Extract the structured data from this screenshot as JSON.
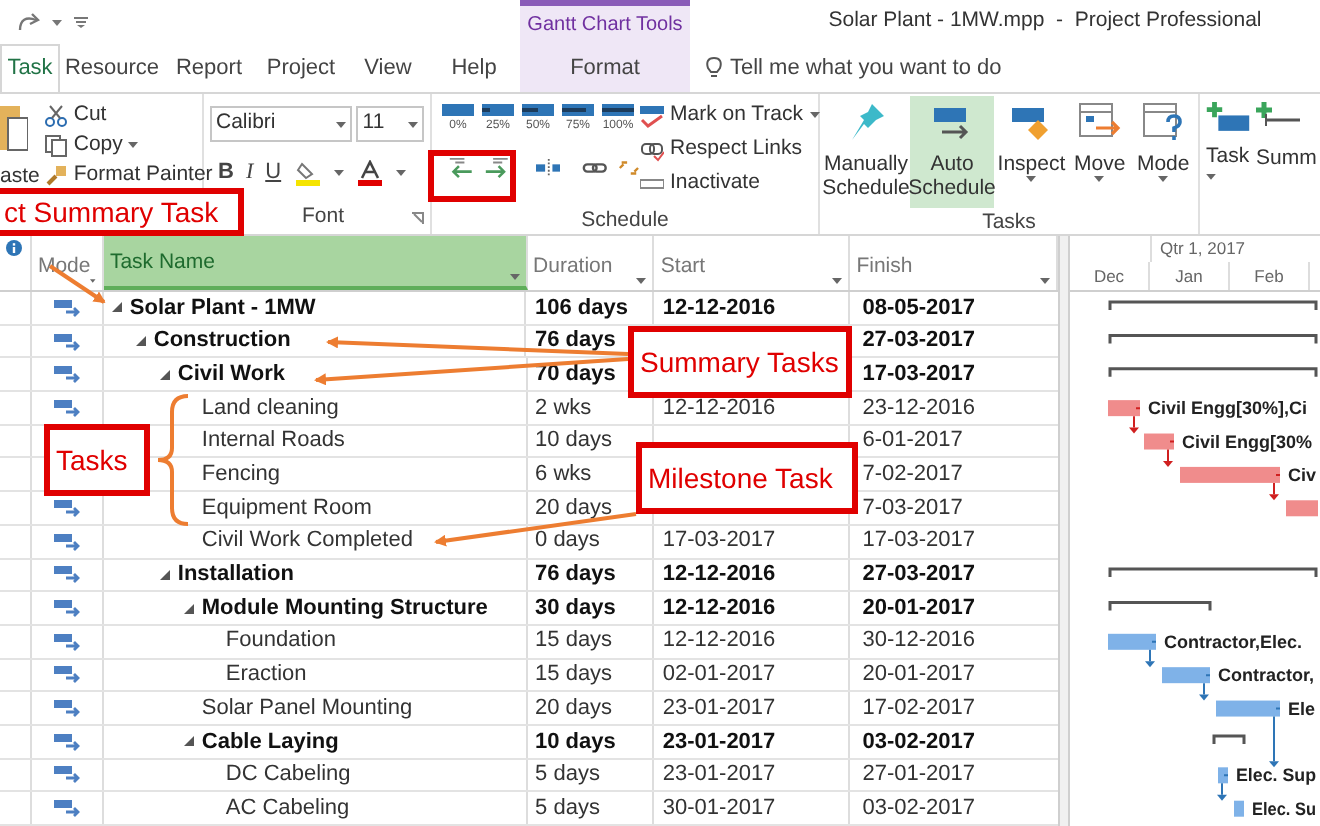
{
  "title_bar": {
    "title": "Solar Plant - 1MW.mpp  -  Project Professional",
    "contextual_header": "Gantt Chart Tools"
  },
  "tabs": [
    {
      "label": "Task",
      "selected": true,
      "kind": "standard"
    },
    {
      "label": "Resource",
      "selected": false,
      "kind": "standard"
    },
    {
      "label": "Report",
      "selected": false,
      "kind": "standard"
    },
    {
      "label": "Project",
      "selected": false,
      "kind": "standard"
    },
    {
      "label": "View",
      "selected": false,
      "kind": "standard"
    },
    {
      "label": "Help",
      "selected": false,
      "kind": "standard"
    },
    {
      "label": "Format",
      "selected": false,
      "kind": "contextual"
    }
  ],
  "tell_me": {
    "placeholder": "Tell me what you want to do"
  },
  "ribbon": {
    "clipboard": {
      "paste": "aste",
      "cut": "Cut",
      "copy": "Copy",
      "format_painter": "Format Painter"
    },
    "font": {
      "font_name": "Calibri",
      "font_size": "11",
      "bold": "B",
      "italic": "I",
      "underline": "U",
      "label": "Font"
    },
    "schedule": {
      "percent_buttons": [
        "0%",
        "25%",
        "50%",
        "75%",
        "100%"
      ],
      "commands": [
        "Mark on Track",
        "Respect Links",
        "Inactivate"
      ],
      "label": "Schedule"
    },
    "tasks": {
      "buttons": [
        {
          "label": "Manually Schedule",
          "selected": false
        },
        {
          "label": "Auto Schedule",
          "selected": true
        },
        {
          "label": "Inspect",
          "selected": false
        },
        {
          "label": "Move",
          "selected": false
        },
        {
          "label": "Mode",
          "selected": false
        }
      ],
      "label": "Tasks"
    },
    "insert": {
      "buttons": [
        "Task",
        "Summ"
      ]
    }
  },
  "table": {
    "columns": [
      {
        "label": "Mode",
        "selected": false
      },
      {
        "label": "Task Name",
        "selected": true
      },
      {
        "label": "Duration",
        "selected": false
      },
      {
        "label": "Start",
        "selected": false
      },
      {
        "label": "Finish",
        "selected": false
      }
    ],
    "rows": [
      {
        "name": "Solar Plant - 1MW",
        "duration": "106 days",
        "start": "12-12-2016",
        "finish": "08-05-2017",
        "kind": "summary",
        "expanded": true,
        "bar": {
          "kind": "summary"
        },
        "children": [
          {
            "name": "Construction",
            "duration": "76 days",
            "finish": "27-03-2017",
            "kind": "summary",
            "expanded": true,
            "bar": {
              "kind": "summary"
            },
            "children": [
              {
                "name": "Civil Work",
                "duration": "70 days",
                "finish": "17-03-2017",
                "kind": "summary",
                "expanded": true,
                "bar": {
                  "kind": "summary"
                },
                "children": [
                  {
                    "name": "Land cleaning",
                    "duration": "2 wks",
                    "start": "12-12-2016",
                    "finish": "23-12-2016",
                    "kind": "task",
                    "bar": {
                      "kind": "task",
                      "color": "#f08c8c",
                      "label": "Civil Engg[30%],Ci"
                    }
                  },
                  {
                    "name": "Internal Roads",
                    "duration": "10 days",
                    "finish": "6-01-2017",
                    "kind": "task",
                    "bar": {
                      "kind": "task",
                      "color": "#f08c8c",
                      "label": "Civil Engg[30%"
                    }
                  },
                  {
                    "name": "Fencing",
                    "duration": "6 wks",
                    "finish": "7-02-2017",
                    "kind": "task",
                    "bar": {
                      "kind": "task",
                      "color": "#f08c8c",
                      "label": "Civ"
                    }
                  },
                  {
                    "name": "Equipment Room",
                    "duration": "20 days",
                    "finish": "7-03-2017",
                    "kind": "task",
                    "bar": {
                      "kind": "task",
                      "color": "#f08c8c"
                    }
                  },
                  {
                    "name": "Civil Work Completed",
                    "duration": "0 days",
                    "start": "17-03-2017",
                    "finish": "17-03-2017",
                    "kind": "task"
                  }
                ]
              },
              {
                "name": "Installation",
                "duration": "76 days",
                "start": "12-12-2016",
                "finish": "27-03-2017",
                "kind": "summary",
                "expanded": true,
                "bar": {
                  "kind": "summary"
                },
                "children": [
                  {
                    "name": "Module Mounting Structure",
                    "duration": "30 days",
                    "start": "12-12-2016",
                    "finish": "20-01-2017",
                    "kind": "summary",
                    "expanded": true,
                    "bar": {
                      "kind": "summary"
                    },
                    "children": [
                      {
                        "name": "Foundation",
                        "duration": "15 days",
                        "start": "12-12-2016",
                        "finish": "30-12-2016",
                        "kind": "task",
                        "bar": {
                          "kind": "task",
                          "color": "#7fb2e8",
                          "label": "Contractor,Elec."
                        }
                      },
                      {
                        "name": "Eraction",
                        "duration": "15 days",
                        "start": "02-01-2017",
                        "finish": "20-01-2017",
                        "kind": "task",
                        "bar": {
                          "kind": "task",
                          "color": "#7fb2e8",
                          "label": "Contractor,"
                        }
                      }
                    ]
                  },
                  {
                    "name": "Solar Panel Mounting",
                    "duration": "20 days",
                    "start": "23-01-2017",
                    "finish": "17-02-2017",
                    "kind": "task",
                    "bar": {
                      "kind": "task",
                      "color": "#7fb2e8",
                      "label": "Ele"
                    }
                  },
                  {
                    "name": "Cable Laying",
                    "duration": "10 days",
                    "start": "23-01-2017",
                    "finish": "03-02-2017",
                    "kind": "summary",
                    "expanded": true,
                    "bar": {
                      "kind": "summary"
                    },
                    "children": [
                      {
                        "name": "DC Cabeling",
                        "duration": "5 days",
                        "start": "23-01-2017",
                        "finish": "27-01-2017",
                        "kind": "task",
                        "bar": {
                          "kind": "task",
                          "color": "#7fb2e8",
                          "label": "Elec. Sup"
                        }
                      },
                      {
                        "name": "AC Cabeling",
                        "duration": "5 days",
                        "start": "30-01-2017",
                        "finish": "03-02-2017",
                        "kind": "task",
                        "bar": {
                          "kind": "task",
                          "color": "#7fb2e8",
                          "label": "Elec. Su"
                        }
                      }
                    ]
                  }
                ]
              }
            ]
          }
        ]
      }
    ]
  },
  "gantt": {
    "quarter": "Qtr 1, 2017",
    "months": [
      "Dec",
      "Jan",
      "Feb"
    ]
  },
  "annotations": [
    {
      "label": "ct Summary Task"
    },
    {
      "label": "Tasks"
    },
    {
      "label": "Summary Tasks"
    },
    {
      "label": "Milestone Task"
    }
  ]
}
